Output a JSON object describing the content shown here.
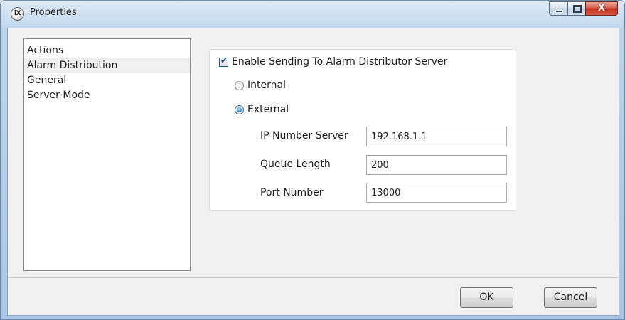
{
  "window": {
    "title": "Properties",
    "app_icon_text": "iX",
    "close_glyph": "X"
  },
  "nav": {
    "items": [
      {
        "label": "Actions"
      },
      {
        "label": "Alarm Distribution",
        "selected": true
      },
      {
        "label": "General"
      },
      {
        "label": "Server Mode"
      }
    ]
  },
  "alarm_distribution": {
    "enable_label": "Enable Sending To Alarm Distributor Server",
    "enable_checked": true,
    "mode_options": [
      {
        "label": "Internal",
        "checked": false
      },
      {
        "label": "External",
        "checked": true
      }
    ],
    "fields": [
      {
        "label": "IP Number Server",
        "value": "192.168.1.1"
      },
      {
        "label": "Queue Length",
        "value": "200"
      },
      {
        "label": "Port Number",
        "value": "13000"
      }
    ]
  },
  "footer": {
    "ok_label": "OK",
    "cancel_label": "Cancel"
  },
  "icons": {
    "app": "ix-logo-icon",
    "minimize": "minimize-icon",
    "maximize": "maximize-icon",
    "close": "close-icon"
  }
}
